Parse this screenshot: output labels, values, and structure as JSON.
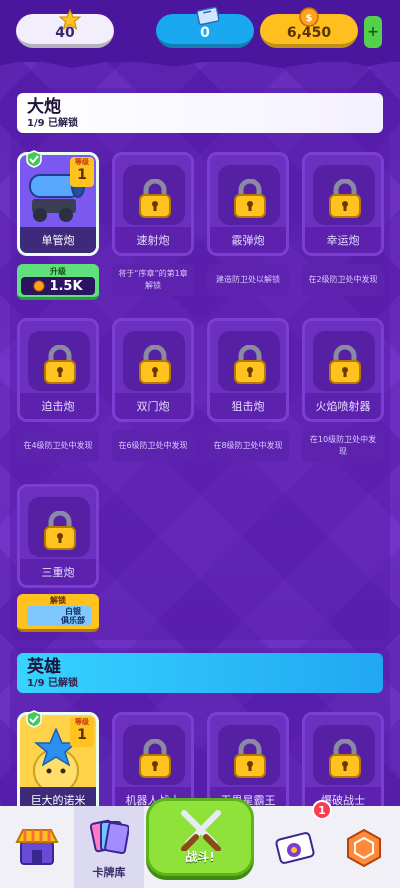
{
  "topbar": {
    "stars": "40",
    "tickets": "0",
    "coins": "6,450",
    "plus_label": "+"
  },
  "sections": {
    "cannon": {
      "title": "大炮",
      "progress": "1/9 已解锁"
    },
    "hero": {
      "title": "英雄",
      "progress": "1/9 已解锁"
    }
  },
  "cannon_cards": [
    {
      "name": "单管炮",
      "rank_label": "等级",
      "rank": "1"
    },
    {
      "name": "速射炮",
      "caption": "将于“序章”的第1章解锁"
    },
    {
      "name": "霰弹炮",
      "caption": "建造防卫处以解锁"
    },
    {
      "name": "幸运炮",
      "caption": "在2级防卫处中发现"
    },
    {
      "name": "迫击炮",
      "caption": "在4级防卫处中发现"
    },
    {
      "name": "双门炮",
      "caption": "在6级防卫处中发现"
    },
    {
      "name": "狙击炮",
      "caption": "在8级防卫处中发现"
    },
    {
      "name": "火焰喷射器",
      "caption": "在10级防卫处中发现"
    },
    {
      "name": "三重炮"
    }
  ],
  "upgrade": {
    "label": "升级",
    "cost": "1.5K"
  },
  "unlock": {
    "label": "解锁",
    "ticket_text": "白银\n俱乐部"
  },
  "hero_cards": [
    {
      "name": "巨大的诺米",
      "rank_label": "等级",
      "rank": "1"
    },
    {
      "name": "机器人战士"
    },
    {
      "name": "无畏星霸王"
    },
    {
      "name": "爆破战士"
    }
  ],
  "nav": {
    "cards_label": "卡牌库",
    "battle_label": "战斗!",
    "events_badge": "1"
  },
  "colors": {
    "background": "#5b1fb8",
    "accent_green": "#8ee23a",
    "accent_yellow": "#ffc21f",
    "accent_blue": "#20a7f2"
  }
}
